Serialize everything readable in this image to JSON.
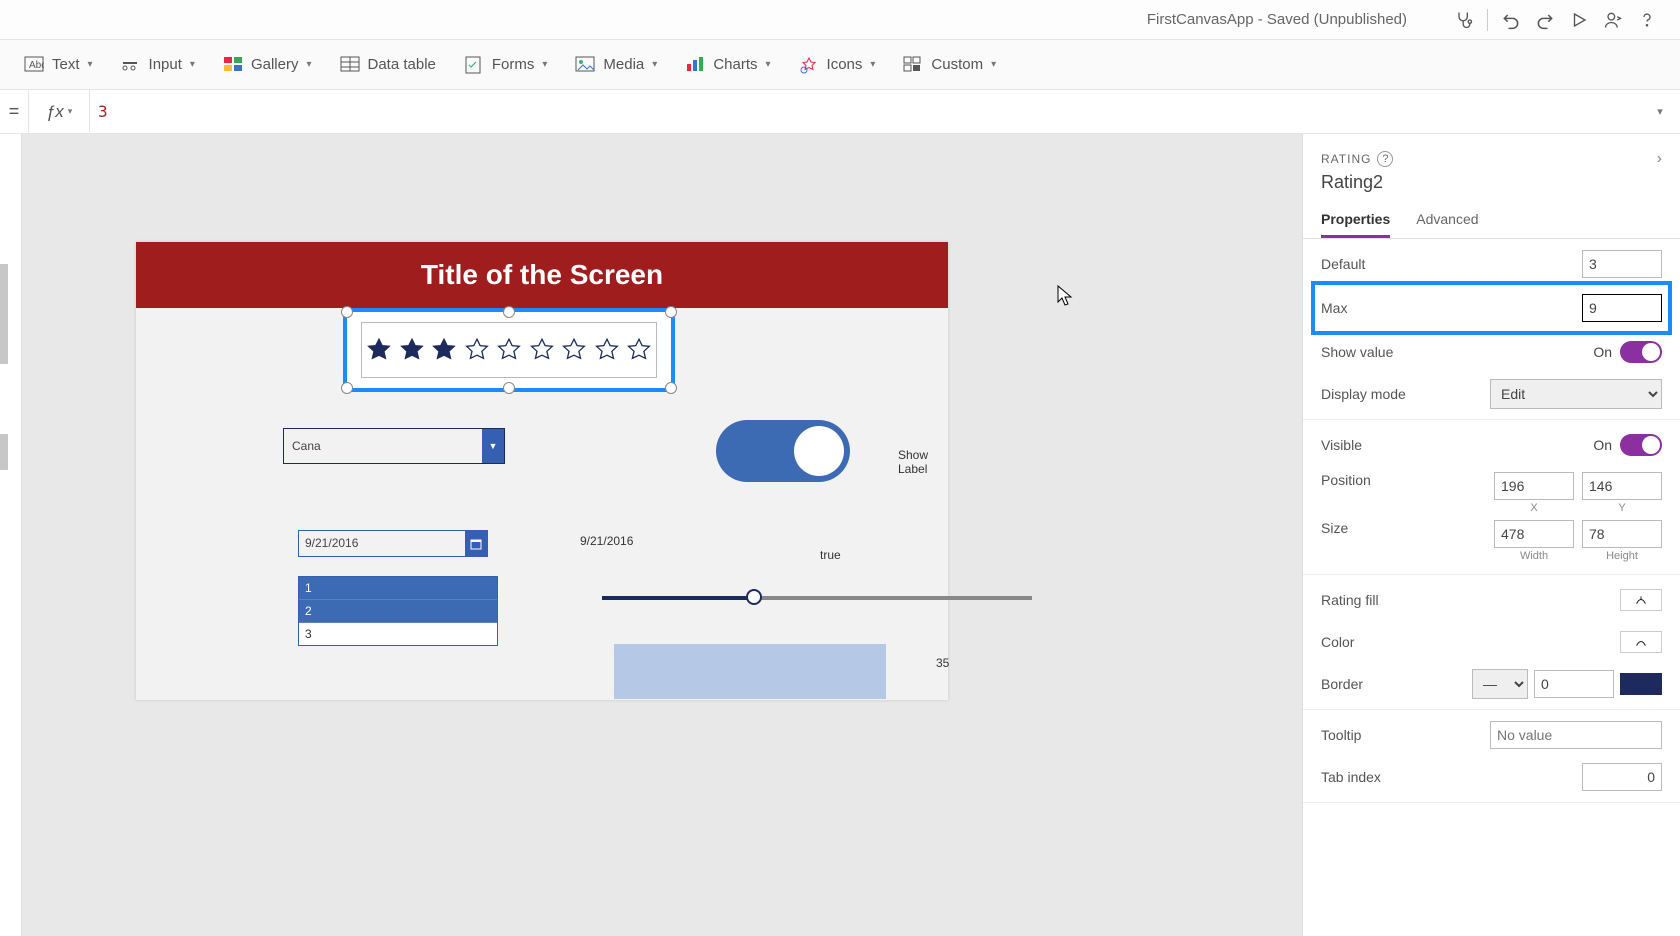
{
  "titlebar": {
    "apptitle": "FirstCanvasApp - Saved (Unpublished)"
  },
  "ribbon": {
    "text": "Text",
    "input": "Input",
    "gallery": "Gallery",
    "datatable": "Data table",
    "forms": "Forms",
    "media": "Media",
    "charts": "Charts",
    "icons": "Icons",
    "custom": "Custom"
  },
  "formula": {
    "value": "3"
  },
  "canvas": {
    "title": "Title of the Screen",
    "rating_filled": 3,
    "rating_max": 9,
    "dropdown_value": "Cana",
    "show_label": "Show Label",
    "date_value": "9/21/2016",
    "date_label": "9/21/2016",
    "toggle_text": "true",
    "list": {
      "i1": "1",
      "i2": "2",
      "i3": "3"
    },
    "slider_value": "35"
  },
  "panel": {
    "type": "RATING",
    "name": "Rating2",
    "tabs": {
      "properties": "Properties",
      "advanced": "Advanced"
    },
    "default": {
      "label": "Default",
      "value": "3"
    },
    "max": {
      "label": "Max",
      "value": "9"
    },
    "showvalue": {
      "label": "Show value",
      "state": "On"
    },
    "displaymode": {
      "label": "Display mode",
      "value": "Edit"
    },
    "visible": {
      "label": "Visible",
      "state": "On"
    },
    "position": {
      "label": "Position",
      "x": "196",
      "y": "146",
      "xlabel": "X",
      "ylabel": "Y"
    },
    "size": {
      "label": "Size",
      "w": "478",
      "h": "78",
      "wlabel": "Width",
      "hlabel": "Height"
    },
    "ratingfill": {
      "label": "Rating fill"
    },
    "color": {
      "label": "Color"
    },
    "border": {
      "label": "Border",
      "width": "0"
    },
    "tooltip": {
      "label": "Tooltip",
      "placeholder": "No value"
    },
    "tabindex": {
      "label": "Tab index",
      "value": "0"
    }
  }
}
